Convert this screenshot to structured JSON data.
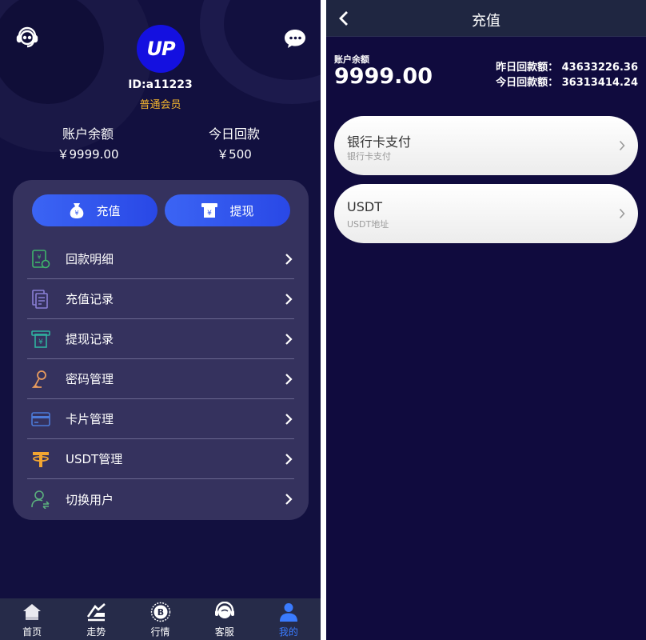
{
  "profile": {
    "logo_text": "UP",
    "user_id": "ID:a11223",
    "member_level": "普通会员"
  },
  "stats": {
    "balance_label": "账户余额",
    "balance_value": "￥9999.00",
    "today_label": "今日回款",
    "today_value": "￥500"
  },
  "actions": {
    "recharge_label": "充值",
    "withdraw_label": "提现"
  },
  "menu": [
    {
      "label": "回款明细",
      "icon": "refund-detail-icon",
      "color": "#3fb56b"
    },
    {
      "label": "充值记录",
      "icon": "recharge-record-icon",
      "color": "#8a7fd6"
    },
    {
      "label": "提现记录",
      "icon": "withdraw-record-icon",
      "color": "#2fb3a0"
    },
    {
      "label": "密码管理",
      "icon": "key-icon",
      "color": "#e79a5e"
    },
    {
      "label": "卡片管理",
      "icon": "card-icon",
      "color": "#4c7bd9"
    },
    {
      "label": "USDT管理",
      "icon": "tether-icon",
      "color": "#f2a531"
    },
    {
      "label": "切换用户",
      "icon": "switch-user-icon",
      "color": "#5bb07d"
    }
  ],
  "tabs": [
    {
      "label": "首页",
      "icon": "home-icon",
      "active": false
    },
    {
      "label": "走势",
      "icon": "trend-icon",
      "active": false
    },
    {
      "label": "行情",
      "icon": "bitcoin-icon",
      "active": false
    },
    {
      "label": "客服",
      "icon": "headset-icon",
      "active": false
    },
    {
      "label": "我的",
      "icon": "user-icon",
      "active": true
    }
  ],
  "recharge_page": {
    "title": "充值",
    "balance_label": "账户余额",
    "balance_value": "9999.00",
    "yesterday_refund": "昨日回款额：  43633226.36",
    "today_refund": "今日回款额：  36313414.24",
    "methods": [
      {
        "title": "银行卡支付",
        "subtitle": "银行卡支付"
      },
      {
        "title": "USDT",
        "subtitle": "USDT地址"
      }
    ]
  },
  "colors": {
    "background": "#12103f",
    "card": "#35325e",
    "accent": "#3b64f4",
    "gold": "#f5b62e",
    "tab_active": "#3a7bff"
  }
}
